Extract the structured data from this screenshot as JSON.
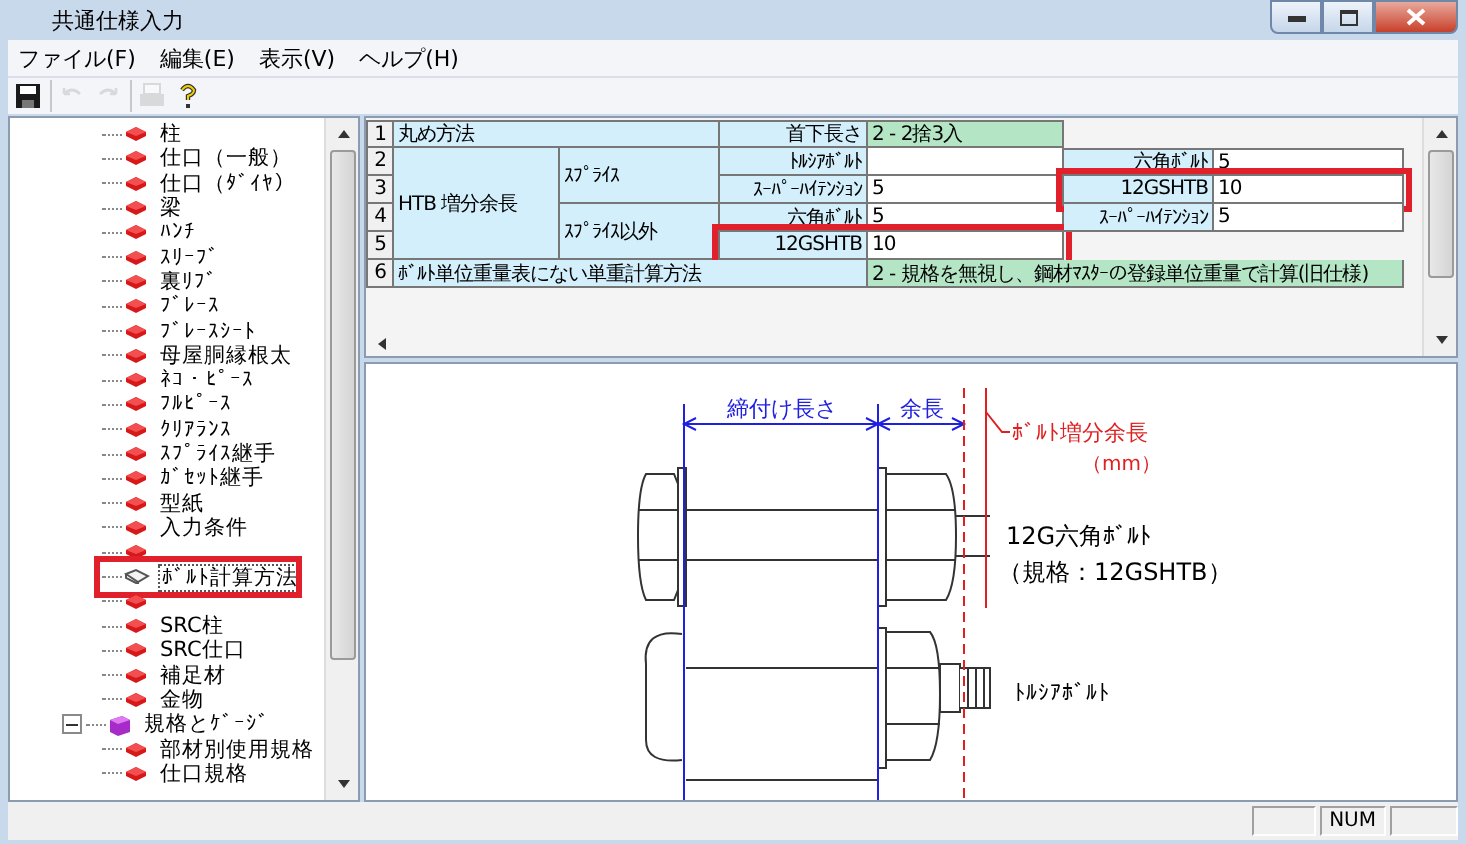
{
  "window": {
    "title": "共通仕様入力"
  },
  "menu": [
    {
      "label": "ファイル(F)"
    },
    {
      "label": "編集(E)"
    },
    {
      "label": "表示(V)"
    },
    {
      "label": "ヘルプ(H)"
    }
  ],
  "toolbar": [
    [
      {
        "kind": "save",
        "disabled": false
      }
    ],
    [
      {
        "kind": "undo",
        "disabled": true
      },
      {
        "kind": "redo",
        "disabled": true
      }
    ],
    [
      {
        "kind": "print",
        "disabled": true
      },
      {
        "kind": "help",
        "disabled": false
      }
    ]
  ],
  "tree": [
    {
      "kind": "leaf",
      "label": "柱",
      "selected": false,
      "highlighted": false
    },
    {
      "kind": "leaf",
      "label": "仕口（一般）",
      "selected": false,
      "highlighted": false
    },
    {
      "kind": "leaf",
      "label": "仕口（ﾀﾞｲﾔ）",
      "selected": false,
      "highlighted": false
    },
    {
      "kind": "leaf",
      "label": "梁",
      "selected": false,
      "highlighted": false
    },
    {
      "kind": "leaf",
      "label": "ﾊﾝﾁ",
      "selected": false,
      "highlighted": false
    },
    {
      "kind": "leaf",
      "label": "ｽﾘｰﾌﾞ",
      "selected": false,
      "highlighted": false
    },
    {
      "kind": "leaf",
      "label": "裏ﾘﾌﾞ",
      "selected": false,
      "highlighted": false
    },
    {
      "kind": "leaf",
      "label": "ﾌﾞﾚｰｽ",
      "selected": false,
      "highlighted": false
    },
    {
      "kind": "leaf",
      "label": "ﾌﾞﾚｰｽｼｰﾄ",
      "selected": false,
      "highlighted": false
    },
    {
      "kind": "leaf",
      "label": "母屋胴縁根太",
      "selected": false,
      "highlighted": false
    },
    {
      "kind": "leaf",
      "label": "ﾈｺ・ﾋﾟｰｽ",
      "selected": false,
      "highlighted": false
    },
    {
      "kind": "leaf",
      "label": "ﾌﾙﾋﾟｰｽ",
      "selected": false,
      "highlighted": false
    },
    {
      "kind": "leaf",
      "label": "ｸﾘｱﾗﾝｽ",
      "selected": false,
      "highlighted": false
    },
    {
      "kind": "leaf",
      "label": "ｽﾌﾟﾗｲｽ継手",
      "selected": false,
      "highlighted": false
    },
    {
      "kind": "leaf",
      "label": "ｶﾞｾｯﾄ継手",
      "selected": false,
      "highlighted": false
    },
    {
      "kind": "leaf",
      "label": "型紙",
      "selected": false,
      "highlighted": false
    },
    {
      "kind": "leaf",
      "label": "入力条件",
      "selected": false,
      "highlighted": false
    },
    {
      "kind": "leaf",
      "selected": false,
      "highlighted": false
    },
    {
      "kind": "leaf",
      "label": "ﾎﾞﾙﾄ計算方法",
      "selected": true,
      "highlighted": true
    },
    {
      "kind": "leaf",
      "selected": false,
      "highlighted": false
    },
    {
      "kind": "leaf",
      "label": "SRC柱",
      "selected": false,
      "highlighted": false
    },
    {
      "kind": "leaf",
      "label": "SRC仕口",
      "selected": false,
      "highlighted": false
    },
    {
      "kind": "leaf",
      "label": "補足材",
      "selected": false,
      "highlighted": false
    },
    {
      "kind": "leaf",
      "label": "金物",
      "selected": false,
      "highlighted": false
    },
    {
      "kind": "folder",
      "label": "規格とｹﾞｰｼﾞ",
      "selected": false,
      "highlighted": false,
      "expanded": true,
      "children": [
        {
          "kind": "leaf",
          "label": "部材別使用規格",
          "selected": false,
          "highlighted": false
        },
        {
          "kind": "leaf",
          "label": "仕口規格",
          "selected": false,
          "highlighted": false
        }
      ]
    }
  ],
  "settings_grid": {
    "row_numbers": [
      "1",
      "2",
      "3",
      "4",
      "5",
      "6"
    ],
    "rounding": {
      "label": "丸め方法",
      "sub_label": "首下長さ",
      "value": "2 - 2捨3入"
    },
    "htb_allowance": {
      "label": "HTB 増分余長",
      "groups": [
        {
          "label": "ｽﾌﾟﾗｲｽ",
          "items": [
            {
              "label": "ﾄﾙｼｱﾎﾞﾙﾄ",
              "highlighted": false
            },
            {
              "label": "ｽｰﾊﾟｰﾊｲﾃﾝｼｮﾝ",
              "value": "5",
              "highlighted": false
            }
          ]
        },
        {
          "label": "ｽﾌﾟﾗｲｽ以外",
          "items": [
            {
              "label": "六角ﾎﾞﾙﾄ",
              "value": "5",
              "highlighted": false
            },
            {
              "label": "12GSHTB",
              "value": "10",
              "highlighted": true
            }
          ]
        }
      ],
      "side_items": [
        {
          "label": "六角ﾎﾞﾙﾄ",
          "value": "5",
          "highlighted": false
        },
        {
          "label": "12GSHTB",
          "value": "10",
          "highlighted": true
        },
        {
          "label": "ｽｰﾊﾟｰﾊｲﾃﾝｼｮﾝ",
          "value": "5",
          "highlighted": false
        }
      ]
    },
    "unit_weight": {
      "label": "ﾎﾞﾙﾄ単位重量表にない単重計算方法",
      "value": "2 - 規格を無視し、鋼材ﾏｽﾀｰの登録単位重量で計算(旧仕様)"
    }
  },
  "diagram": {
    "clamp_length": "締付け長さ",
    "extra_length": "余長",
    "bolt_allowance": "ﾎﾞﾙﾄ増分余長",
    "unit": "（mm）",
    "hex_bolt": "12G六角ﾎﾞﾙﾄ",
    "hex_bolt_spec": "（規格：12GSHTB）",
    "torshear_bolt": "ﾄﾙｼｱﾎﾞﾙﾄ"
  },
  "status_bar": {
    "indicators": [
      "NUM"
    ]
  }
}
